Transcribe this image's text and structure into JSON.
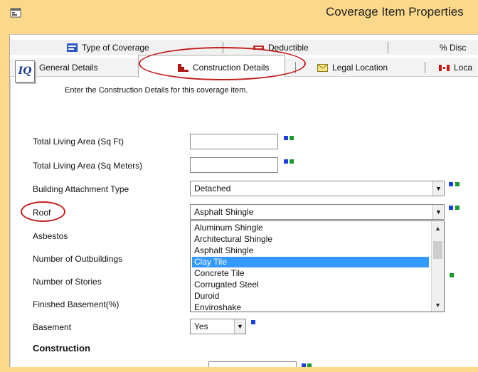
{
  "window": {
    "title": "Coverage Item Properties",
    "app_icon": "properties-icon"
  },
  "tabs_row1": [
    {
      "label": "Type of Coverage",
      "icon": "coverage-icon"
    },
    {
      "label": "Deductible",
      "icon": "deductible-icon"
    },
    {
      "label": "% Disc",
      "icon": "percent-icon"
    }
  ],
  "tabs_row2": [
    {
      "label": "General Details",
      "icon": "car-icon"
    },
    {
      "label": "Construction Details",
      "icon": "building-icon",
      "active": true
    },
    {
      "label": "Legal Location",
      "icon": "envelope-icon"
    },
    {
      "label": "Loca",
      "icon": "flag-icon"
    }
  ],
  "intro_text": "Enter the Construction Details for this coverage item.",
  "fields": {
    "living_area_sqft": {
      "label": "Total Living Area (Sq Ft)",
      "value": ""
    },
    "living_area_sqm": {
      "label": "Total Living Area (Sq Meters)",
      "value": ""
    },
    "building_attachment": {
      "label": "Building Attachment Type",
      "value": "Detached"
    },
    "roof": {
      "label": "Roof",
      "value": "Asphalt Shingle"
    },
    "asbestos": {
      "label": "Asbestos"
    },
    "outbuildings": {
      "label": "Number of Outbuildings"
    },
    "stories": {
      "label": "Number of Stories"
    },
    "finished_basement": {
      "label": "Finished Basement(%)"
    },
    "basement": {
      "label": "Basement",
      "value": "Yes"
    }
  },
  "section_construction": "Construction",
  "roof_options": [
    "Aluminum Shingle",
    "Architectural Shingle",
    "Asphalt Shingle",
    "Clay Tile",
    "Concrete Tile",
    "Corrugated Steel",
    "Duroid",
    "Enviroshake"
  ],
  "roof_highlighted": "Clay Tile",
  "colors": {
    "frame": "#fbd88a",
    "highlight": "#3399ff",
    "annotation": "#c11d1d",
    "blue_marker": "#1d3fe0",
    "green_marker": "#1a9a2a"
  }
}
